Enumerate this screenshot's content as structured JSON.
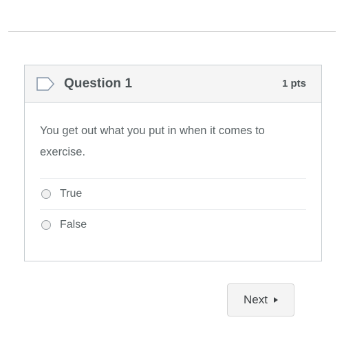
{
  "page": {
    "divider": "top-rule"
  },
  "question": {
    "icon": "tag-icon",
    "title": "Question 1",
    "points": "1 pts",
    "text": "You get out what you put in when it comes to exercise.",
    "options": [
      {
        "label": "True",
        "selected": false
      },
      {
        "label": "False",
        "selected": false
      }
    ]
  },
  "footer": {
    "next_label": "Next",
    "next_arrow_icon": "caret-right-icon"
  },
  "colors": {
    "card_border": "#c7cdd1",
    "header_background": "#f5f5f5",
    "text": "#5b6366",
    "heading": "#4c5356",
    "divider": "#eceef0",
    "button_background": "#f4f4f4",
    "button_border": "#d5d5d5",
    "radio_border": "#9aa0a4",
    "tag_icon_stroke": "#8a99ab"
  }
}
